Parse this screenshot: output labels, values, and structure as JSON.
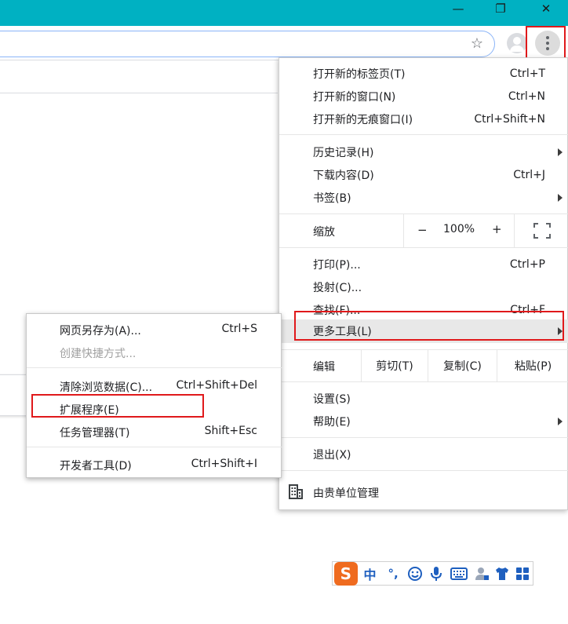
{
  "window": {
    "minimize_glyph": "—",
    "restore_glyph": "❐",
    "close_glyph": "✕"
  },
  "toolbar": {
    "bookmark_icon": "star-icon",
    "star_glyph": "☆",
    "profile_icon": "account-icon",
    "menu_icon": "more-vert-icon"
  },
  "main_menu": {
    "new_tab": {
      "label": "打开新的标签页(T)",
      "shortcut": "Ctrl+T"
    },
    "new_window": {
      "label": "打开新的窗口(N)",
      "shortcut": "Ctrl+N"
    },
    "incognito": {
      "label": "打开新的无痕窗口(I)",
      "shortcut": "Ctrl+Shift+N"
    },
    "history": {
      "label": "历史记录(H)"
    },
    "downloads": {
      "label": "下载内容(D)",
      "shortcut": "Ctrl+J"
    },
    "bookmarks": {
      "label": "书签(B)"
    },
    "zoom": {
      "label": "缩放",
      "minus": "−",
      "value": "100%",
      "plus": "+"
    },
    "print": {
      "label": "打印(P)...",
      "shortcut": "Ctrl+P"
    },
    "cast": {
      "label": "投射(C)..."
    },
    "find": {
      "label": "查找(F)...",
      "shortcut": "Ctrl+F"
    },
    "more_tools": {
      "label": "更多工具(L)"
    },
    "edit": {
      "label": "编辑",
      "cut": "剪切(T)",
      "copy": "复制(C)",
      "paste": "粘贴(P)"
    },
    "settings": {
      "label": "设置(S)"
    },
    "help": {
      "label": "帮助(E)"
    },
    "exit": {
      "label": "退出(X)"
    },
    "managed": {
      "label": "由贵单位管理"
    }
  },
  "submenu": {
    "save_page": {
      "label": "网页另存为(A)...",
      "shortcut": "Ctrl+S"
    },
    "create_shortcut": {
      "label": "创建快捷方式..."
    },
    "clear_data": {
      "label": "清除浏览数据(C)...",
      "shortcut": "Ctrl+Shift+Del"
    },
    "extensions": {
      "label": "扩展程序(E)"
    },
    "task_manager": {
      "label": "任务管理器(T)",
      "shortcut": "Shift+Esc"
    },
    "dev_tools": {
      "label": "开发者工具(D)",
      "shortcut": "Ctrl+Shift+I"
    }
  },
  "ime": {
    "logo": "S",
    "mode": "中",
    "punct": "°,",
    "icons": [
      "emoji-icon",
      "microphone-icon",
      "keyboard-icon",
      "user-icon",
      "skin-icon",
      "grid-icon"
    ]
  },
  "colors": {
    "titlebar": "#00b1c2",
    "highlight_red": "#e0191b",
    "ime_orange": "#ef6b1f",
    "ime_blue": "#1e5fbf"
  }
}
